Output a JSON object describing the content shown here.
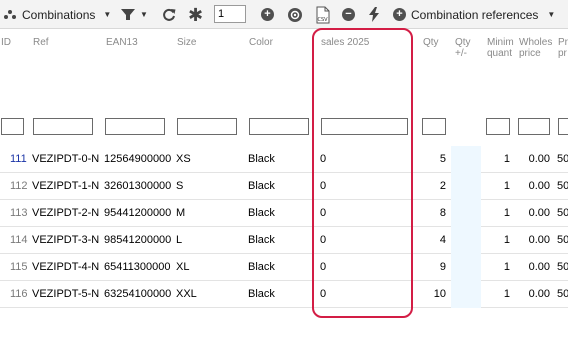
{
  "toolbar": {
    "combinations_label": "Combinations",
    "page_value": "1",
    "csv_label": "CSV",
    "references_label": "Combination references"
  },
  "columns": {
    "id": "ID",
    "ref": "Ref",
    "ean13": "EAN13",
    "size": "Size",
    "color": "Color",
    "sales": "sales 2025",
    "qty": "Qty",
    "qtypm_1": "Qty",
    "qtypm_2": "+/-",
    "min_1": "Minim",
    "min_2": "quant",
    "whole_1": "Wholes",
    "whole_2": "price",
    "price_1": "Pr",
    "price_2": "pr"
  },
  "rows": [
    {
      "id": "111",
      "ref": "VEZIPDT-0-N",
      "ean": "12564900000",
      "size": "XS",
      "color": "Black",
      "sales": "0",
      "qty": "5",
      "min": "1",
      "whole": "0.00",
      "price": "50"
    },
    {
      "id": "112",
      "ref": "VEZIPDT-1-N",
      "ean": "32601300000",
      "size": "S",
      "color": "Black",
      "sales": "0",
      "qty": "2",
      "min": "1",
      "whole": "0.00",
      "price": "50"
    },
    {
      "id": "113",
      "ref": "VEZIPDT-2-N",
      "ean": "95441200000",
      "size": "M",
      "color": "Black",
      "sales": "0",
      "qty": "8",
      "min": "1",
      "whole": "0.00",
      "price": "50"
    },
    {
      "id": "114",
      "ref": "VEZIPDT-3-N",
      "ean": "98541200000",
      "size": "L",
      "color": "Black",
      "sales": "0",
      "qty": "4",
      "min": "1",
      "whole": "0.00",
      "price": "50"
    },
    {
      "id": "115",
      "ref": "VEZIPDT-4-N",
      "ean": "65411300000",
      "size": "XL",
      "color": "Black",
      "sales": "0",
      "qty": "9",
      "min": "1",
      "whole": "0.00",
      "price": "50"
    },
    {
      "id": "116",
      "ref": "VEZIPDT-5-N",
      "ean": "63254100000",
      "size": "XXL",
      "color": "Black",
      "sales": "0",
      "qty": "10",
      "min": "1",
      "whole": "0.00",
      "price": "50"
    }
  ],
  "colors": {
    "highlight": "#d31d45",
    "id_first": "#1a33a6",
    "id_other": "#7a7a7a"
  }
}
